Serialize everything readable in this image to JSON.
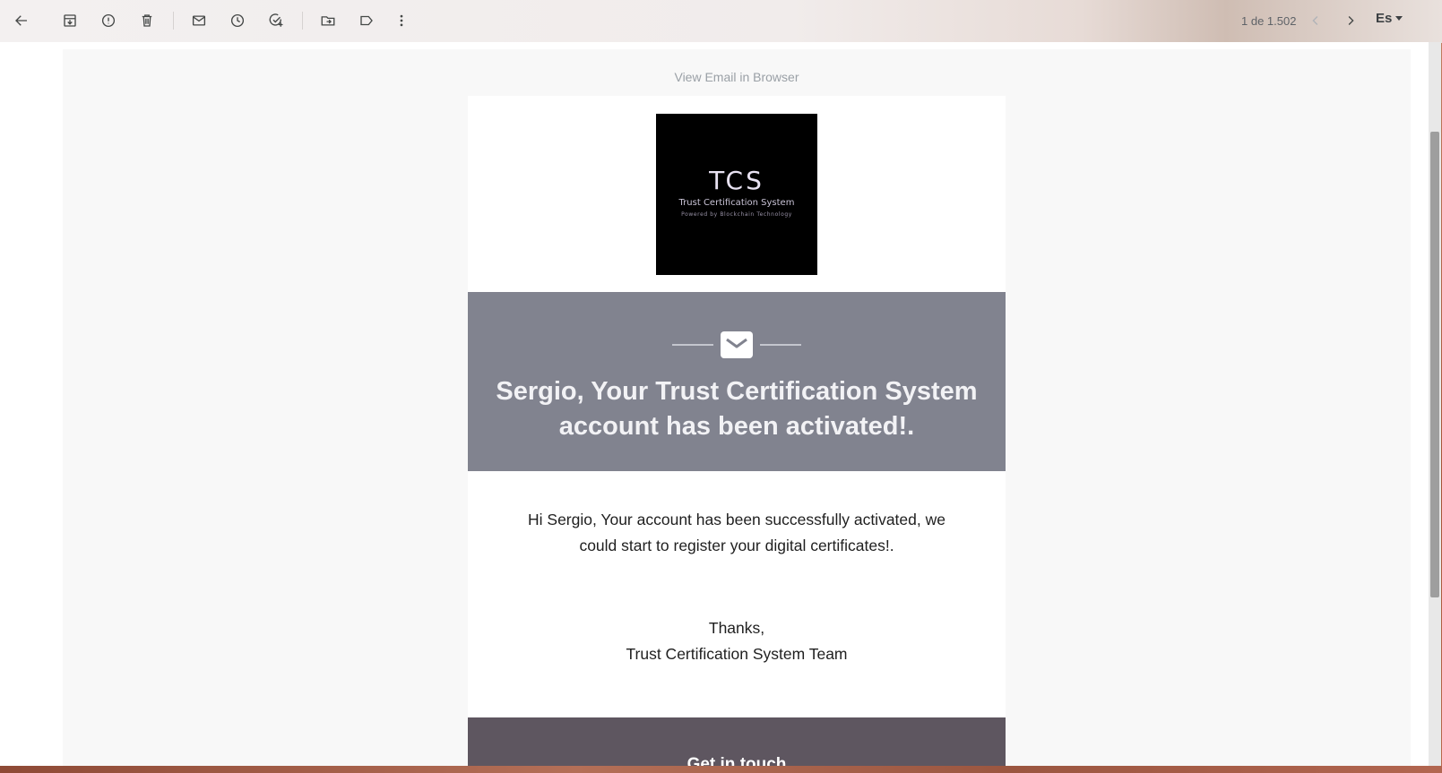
{
  "toolbar": {
    "back": "back-icon",
    "archive": "archive-icon",
    "report_spam": "report-spam-icon",
    "delete": "delete-icon",
    "mark_unread": "mark-unread-icon",
    "snooze": "snooze-icon",
    "add_task": "add-task-icon",
    "move_to": "move-to-icon",
    "label": "label-icon",
    "more": "more-icon",
    "pager_text": "1 de 1.502",
    "prev": "chevron-left-icon",
    "next": "chevron-right-icon",
    "language": "Es"
  },
  "email": {
    "view_in_browser": "View Email in Browser",
    "logo": {
      "title": "TCS",
      "subtitle": "Trust Certification System",
      "tagline": "Powered by Blockchain Technology"
    },
    "banner_title": "Sergio, Your Trust Certification System account has been activated!.",
    "body_text": "Hi Sergio, Your account has been successfully activated, we could start to register your digital certificates!.",
    "thanks_line1": "Thanks,",
    "thanks_line2": "Trust Certification System Team",
    "footer_title": "Get in touch"
  },
  "colors": {
    "banner": "#81838f",
    "footer": "#5e5660",
    "email_background": "#f8f8f8"
  }
}
